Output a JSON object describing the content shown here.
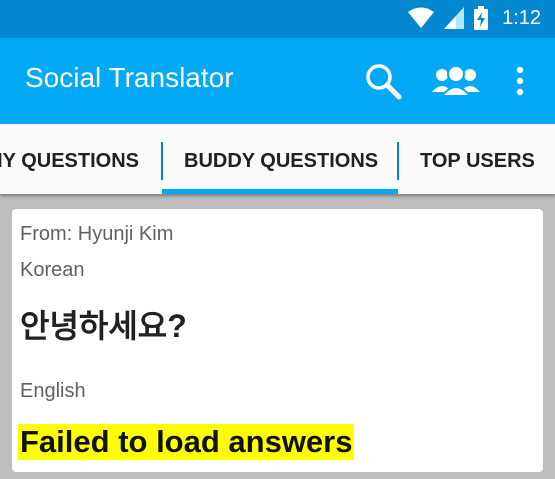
{
  "status_bar": {
    "time": "1:12"
  },
  "app_bar": {
    "title": "Social Translator"
  },
  "tabs": [
    {
      "label": "MY QUESTIONS"
    },
    {
      "label": "BUDDY QUESTIONS"
    },
    {
      "label": "TOP USERS"
    }
  ],
  "card": {
    "from": "From: Hyunji Kim",
    "source_language": "Korean",
    "question": "안녕하세요?",
    "target_language": "English",
    "answer": "Failed to load answers"
  },
  "colors": {
    "status_bar": "#0288d1",
    "app_bar": "#03a9f4",
    "tab_indicator": "#03a9f4",
    "highlight": "#ffff00"
  }
}
